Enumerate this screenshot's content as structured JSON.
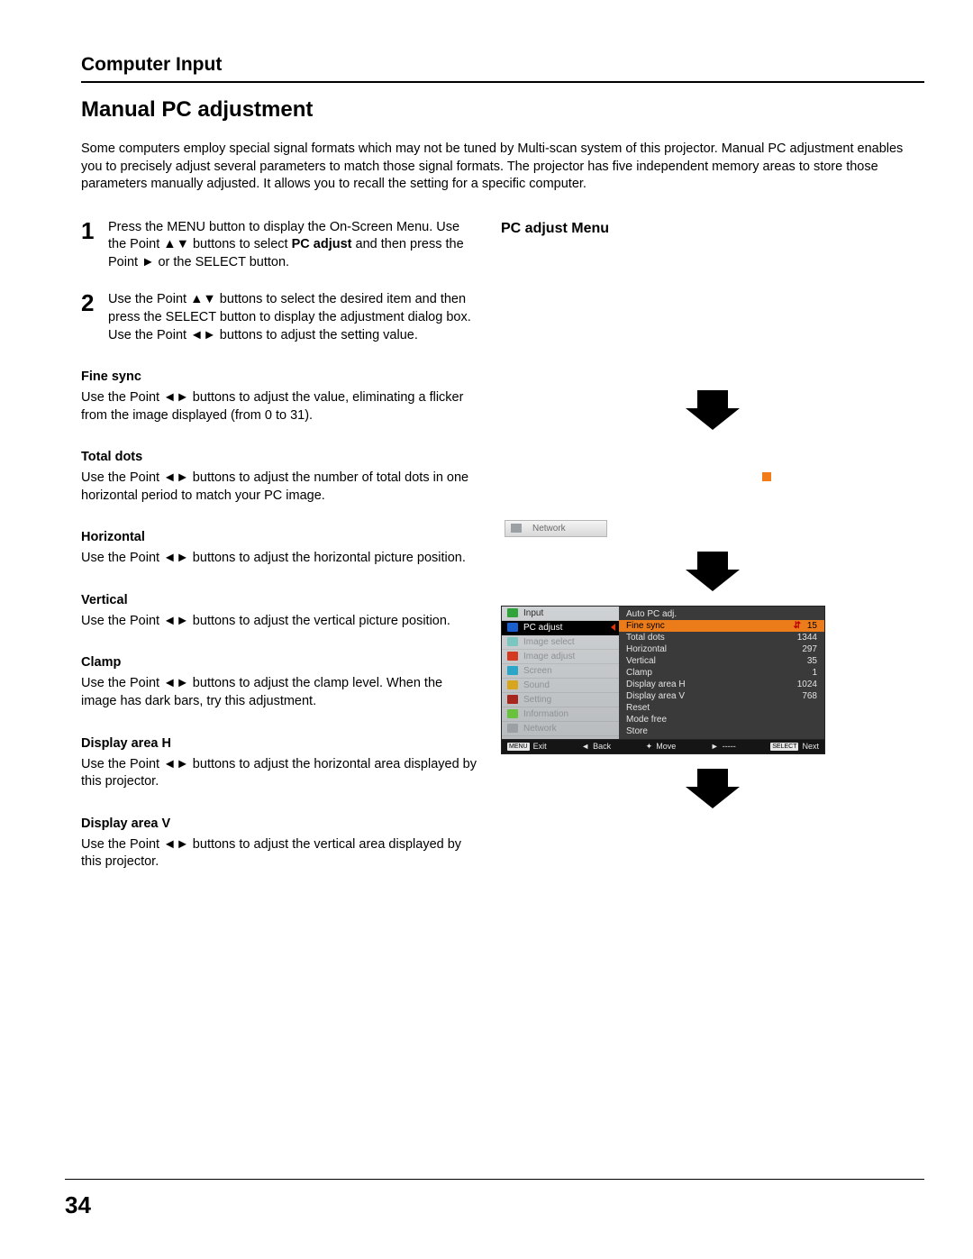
{
  "header": {
    "title": "Computer Input"
  },
  "section": {
    "title": "Manual PC adjustment"
  },
  "intro": "Some computers employ special signal formats which may not be tuned by Multi-scan system of this projector. Manual PC adjustment enables you to precisely adjust several parameters to match those signal formats. The projector has five independent memory areas to store those parameters manually adjusted. It allows you to recall the setting for a specific computer.",
  "steps": [
    {
      "num": "1",
      "text_a": "Press the MENU button to display the On-Screen Menu. Use the Point ▲▼ buttons to select ",
      "bold": "PC adjust",
      "text_b": " and then press the Point ► or the SELECT button."
    },
    {
      "num": "2",
      "text_a": "Use the Point ▲▼ buttons to select the desired item and then press the SELECT button to display the adjustment dialog box. Use the Point ◄► buttons to adjust the setting value.",
      "bold": "",
      "text_b": ""
    }
  ],
  "params": [
    {
      "title": "Fine sync",
      "text": "Use the Point ◄► buttons to adjust the value, eliminating a flicker from the image displayed (from 0 to 31)."
    },
    {
      "title": "Total dots",
      "text": "Use the Point ◄► buttons to adjust the number of total dots in one horizontal period to match your PC image."
    },
    {
      "title": "Horizontal",
      "text": "Use the Point ◄► buttons to adjust the horizontal picture position."
    },
    {
      "title": "Vertical",
      "text": "Use the Point ◄► buttons to adjust the vertical picture position."
    },
    {
      "title": "Clamp",
      "text": "Use the Point ◄► buttons to adjust the clamp level. When the image has dark bars, try this adjustment."
    },
    {
      "title": "Display area H",
      "text": "Use the Point ◄► buttons to adjust the horizontal area displayed by this projector."
    },
    {
      "title": "Display area V",
      "text": "Use the Point ◄► buttons to adjust the vertical area displayed by this projector."
    }
  ],
  "right": {
    "heading": "PC adjust Menu",
    "network_chip": "Network"
  },
  "osd": {
    "left_menu": [
      {
        "label": "Input",
        "icon": "ic-green",
        "dim": false,
        "sel": false
      },
      {
        "label": "PC adjust",
        "icon": "ic-blue",
        "dim": false,
        "sel": true
      },
      {
        "label": "Image select",
        "icon": "ic-teal",
        "dim": true,
        "sel": false
      },
      {
        "label": "Image adjust",
        "icon": "ic-red",
        "dim": true,
        "sel": false
      },
      {
        "label": "Screen",
        "icon": "ic-cyan",
        "dim": true,
        "sel": false
      },
      {
        "label": "Sound",
        "icon": "ic-gold",
        "dim": true,
        "sel": false
      },
      {
        "label": "Setting",
        "icon": "ic-dred",
        "dim": true,
        "sel": false
      },
      {
        "label": "Information",
        "icon": "ic-lime",
        "dim": true,
        "sel": false
      },
      {
        "label": "Network",
        "icon": "ic-grey",
        "dim": true,
        "sel": false
      }
    ],
    "right_menu": [
      {
        "label": "Auto PC adj.",
        "value": "",
        "hl": false
      },
      {
        "label": "Fine sync",
        "value": "15",
        "hl": true
      },
      {
        "label": "Total dots",
        "value": "1344",
        "hl": false
      },
      {
        "label": "Horizontal",
        "value": "297",
        "hl": false
      },
      {
        "label": "Vertical",
        "value": "35",
        "hl": false
      },
      {
        "label": "Clamp",
        "value": "1",
        "hl": false
      },
      {
        "label": "Display area H",
        "value": "1024",
        "hl": false
      },
      {
        "label": "Display area V",
        "value": "768",
        "hl": false
      },
      {
        "label": "Reset",
        "value": "",
        "hl": false
      },
      {
        "label": "Mode free",
        "value": "",
        "hl": false
      },
      {
        "label": "Store",
        "value": "",
        "hl": false
      }
    ],
    "footer": {
      "exit_key": "MENU",
      "exit": "Exit",
      "back_sym": "◄",
      "back": "Back",
      "move_sym": "✦",
      "move": "Move",
      "next_sym": "►",
      "next_dashes": "-----",
      "select_key": "SELECT",
      "select": "Next"
    }
  },
  "page_number": "34"
}
